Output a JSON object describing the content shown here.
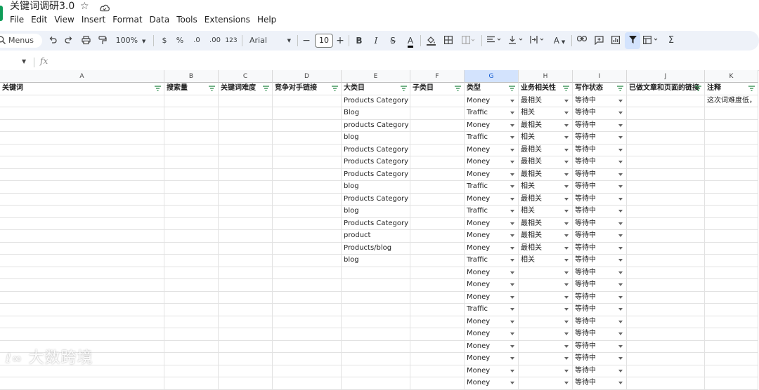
{
  "doc": {
    "title": "关键词调研3.0"
  },
  "menu": [
    "File",
    "Edit",
    "View",
    "Insert",
    "Format",
    "Data",
    "Tools",
    "Extensions",
    "Help"
  ],
  "toolbar": {
    "search_label": "Menus",
    "zoom": "100%",
    "currency": "$",
    "percent": "%",
    "dec_decrease": ".0",
    "dec_increase": ".00",
    "number_format": "123",
    "font": "Arial",
    "font_size": "10"
  },
  "columns": [
    "A",
    "B",
    "C",
    "D",
    "E",
    "F",
    "G",
    "H",
    "I",
    "J",
    "K"
  ],
  "headers": [
    "关键词",
    "搜索量",
    "关键词难度",
    "竞争对手链接",
    "大类目",
    "子类目",
    "类型",
    "业务相关性",
    "写作状态",
    "已做文章和页面的链接",
    "注释"
  ],
  "rows": [
    {
      "e": "Products Category",
      "g": "Money",
      "h": "最相关",
      "i": "等待中",
      "k": "这次词难度低，"
    },
    {
      "e": "Blog",
      "g": "Traffic",
      "h": "相关",
      "i": "等待中",
      "k": ""
    },
    {
      "e": "products Category",
      "g": "Money",
      "h": "最相关",
      "i": "等待中",
      "k": ""
    },
    {
      "e": "blog",
      "g": "Traffic",
      "h": "相关",
      "i": "等待中",
      "k": ""
    },
    {
      "e": "Products Category",
      "g": "Money",
      "h": "最相关",
      "i": "等待中",
      "k": ""
    },
    {
      "e": "Products Category",
      "g": "Money",
      "h": "最相关",
      "i": "等待中",
      "k": ""
    },
    {
      "e": "Products Category",
      "g": "Money",
      "h": "最相关",
      "i": "等待中",
      "k": ""
    },
    {
      "e": "blog",
      "g": "Traffic",
      "h": "相关",
      "i": "等待中",
      "k": ""
    },
    {
      "e": "Products Category",
      "g": "Money",
      "h": "最相关",
      "i": "等待中",
      "k": ""
    },
    {
      "e": "blog",
      "g": "Traffic",
      "h": "相关",
      "i": "等待中",
      "k": ""
    },
    {
      "e": "Products Category",
      "g": "Money",
      "h": "最相关",
      "i": "等待中",
      "k": ""
    },
    {
      "e": "product",
      "g": "Money",
      "h": "最相关",
      "i": "等待中",
      "k": ""
    },
    {
      "e": "Products/blog",
      "g": "Money",
      "h": "最相关",
      "i": "等待中",
      "k": ""
    },
    {
      "e": "blog",
      "g": "Traffic",
      "h": "相关",
      "i": "等待中",
      "k": ""
    },
    {
      "e": "",
      "g": "Money",
      "h": "",
      "i": "等待中",
      "k": ""
    },
    {
      "e": "",
      "g": "Money",
      "h": "",
      "i": "等待中",
      "k": ""
    },
    {
      "e": "",
      "g": "Money",
      "h": "",
      "i": "等待中",
      "k": ""
    },
    {
      "e": "",
      "g": "Traffic",
      "h": "",
      "i": "等待中",
      "k": ""
    },
    {
      "e": "",
      "g": "Money",
      "h": "",
      "i": "等待中",
      "k": ""
    },
    {
      "e": "",
      "g": "Money",
      "h": "",
      "i": "等待中",
      "k": ""
    },
    {
      "e": "",
      "g": "Money",
      "h": "",
      "i": "等待中",
      "k": ""
    },
    {
      "e": "",
      "g": "Money",
      "h": "",
      "i": "等待中",
      "k": ""
    },
    {
      "e": "",
      "g": "Money",
      "h": "",
      "i": "等待中",
      "k": ""
    },
    {
      "e": "",
      "g": "Money",
      "h": "",
      "i": "等待中",
      "k": ""
    }
  ],
  "watermark": "大数跨境",
  "colors": {
    "accent": "#0b57d0",
    "toolbar_bg": "#eef2f9",
    "logo": "#0f9d58"
  }
}
